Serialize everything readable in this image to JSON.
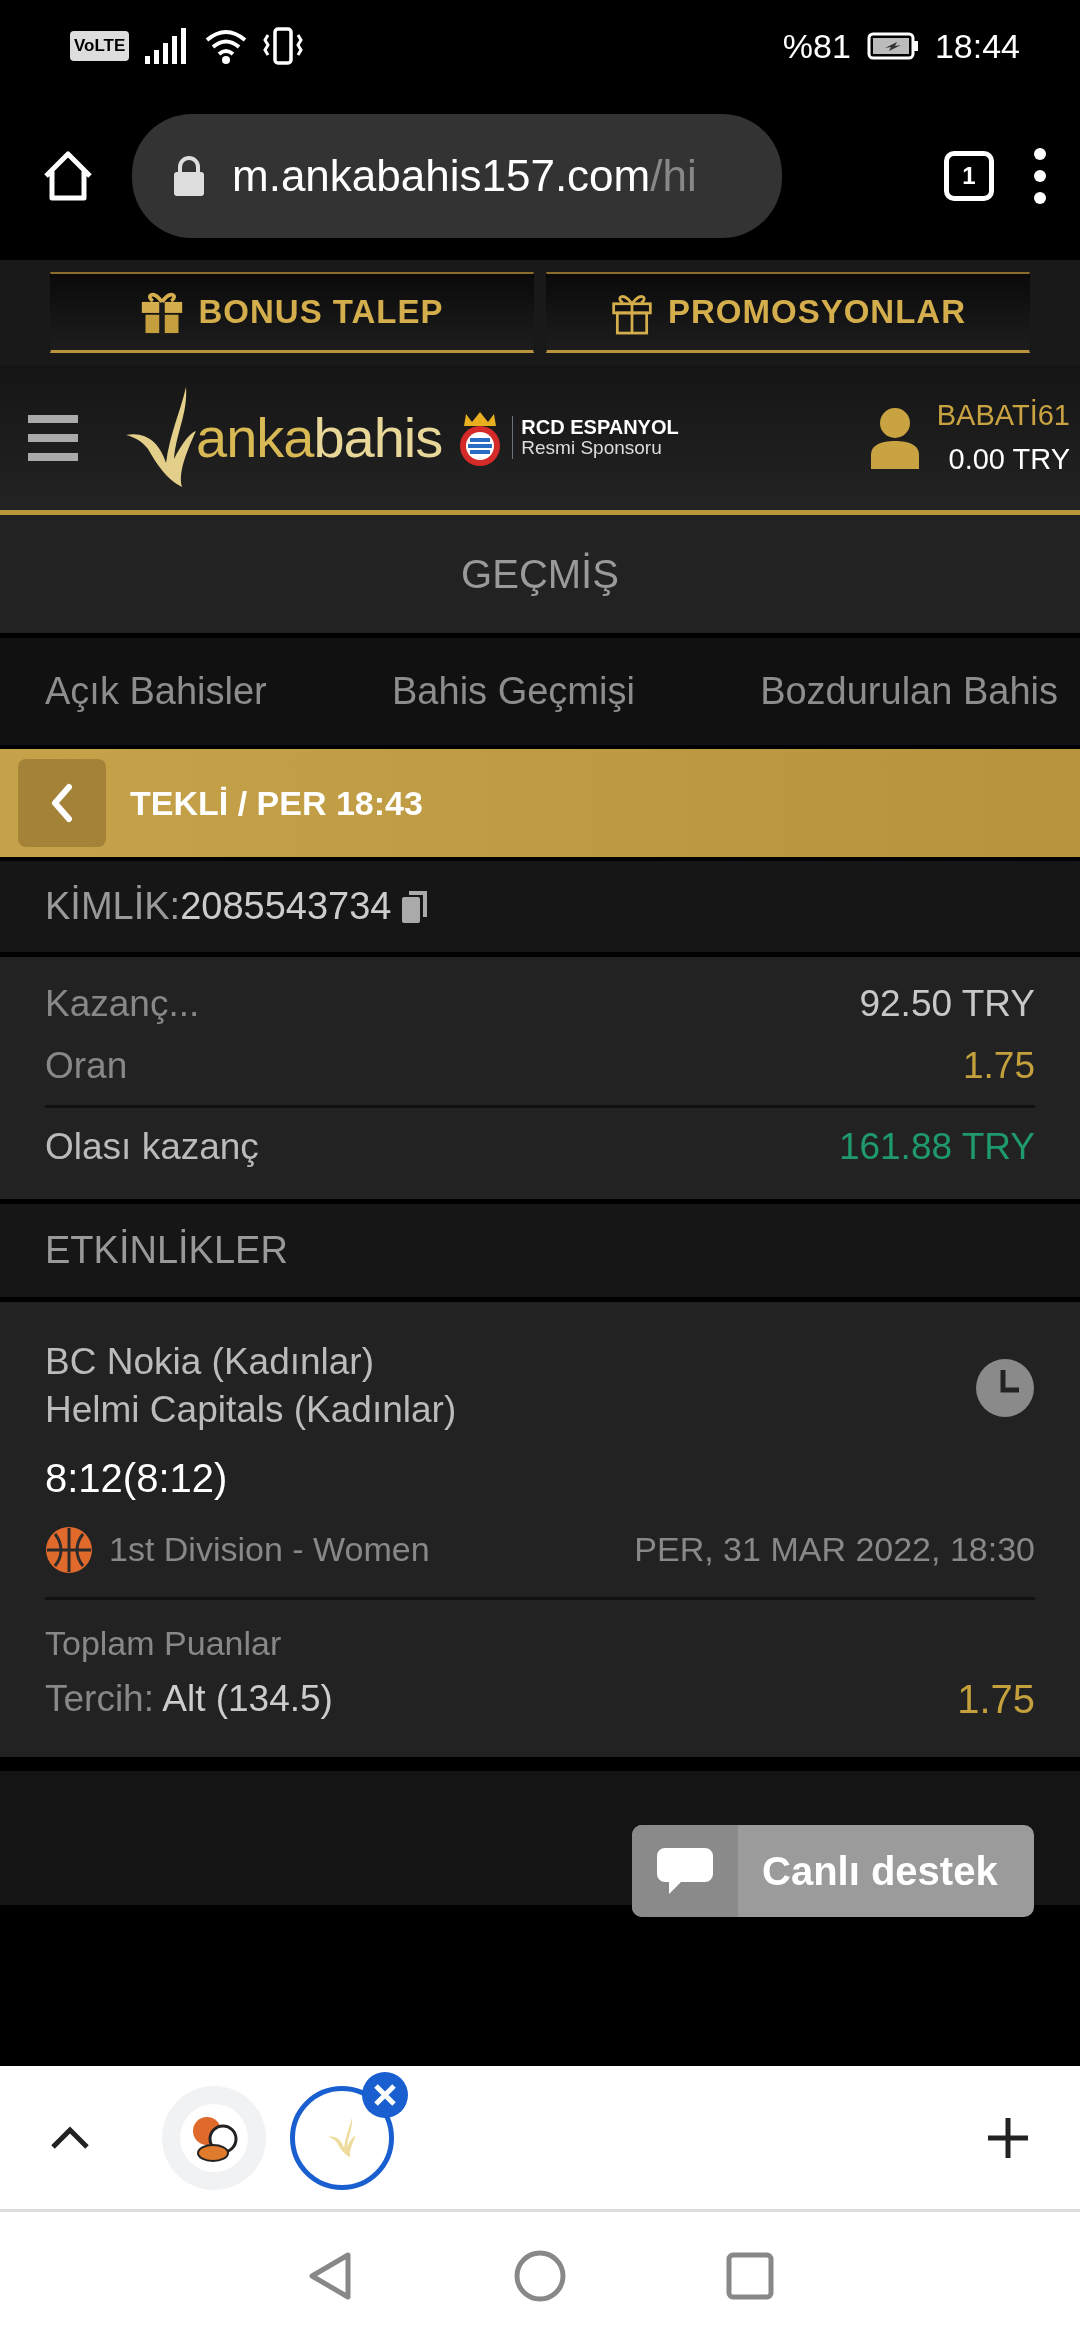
{
  "status_bar": {
    "network_label": "VoLTE",
    "battery_percent": "%81",
    "time": "18:44"
  },
  "browser": {
    "url_host": "m.ankabahis157.com",
    "url_path": "/hi",
    "tab_count": "1"
  },
  "promo_buttons": [
    {
      "label": "BONUS TALEP",
      "kind": "filled"
    },
    {
      "label": "PROMOSYONLAR",
      "kind": "outline"
    }
  ],
  "header": {
    "logo": "**anka**bahis",
    "sponsor_title": "RCD ESPANYOL",
    "sponsor_subtitle": "Resmi Sponsoru",
    "username": "BABATİ61",
    "balance": "0.00 TRY"
  },
  "page_title": "GEÇMİŞ",
  "tabs": [
    {
      "label": "Açık Bahisler",
      "selected": false
    },
    {
      "label": "Bahis Geçmişi",
      "selected": false
    },
    {
      "label": "Bozdurulan Bahis",
      "selected": false
    }
  ],
  "bet_header": {
    "title": "TEKLİ / PER 18:43"
  },
  "ticket": {
    "id_label": "KİMLİK:",
    "id_value": "2085543734"
  },
  "summary": [
    {
      "label": "Kazanç...",
      "value": "92.50 TRY",
      "kind": "stake"
    },
    {
      "label": "Oran",
      "value": "1.75",
      "kind": "odds"
    },
    {
      "label": "Olası kazanç",
      "value": "161.88 TRY",
      "kind": "payout"
    }
  ],
  "events_title": "ETKİNLİKLER",
  "events": [
    {
      "home": "BC Nokia (Kadınlar)",
      "away": "Helmi Capitals (Kadınlar)",
      "score": "8:12(8:12)",
      "league": "1st Division - Women",
      "datetime": "PER, 31 MAR 2022, 18:30",
      "market": "Toplam Puanlar",
      "pick_label": "Tercih:",
      "pick": "Alt (134.5)",
      "odds": "1.75"
    }
  ],
  "chat_button": "Canlı destek",
  "browser_tabs": [
    {
      "selected": false
    },
    {
      "selected": true
    }
  ]
}
